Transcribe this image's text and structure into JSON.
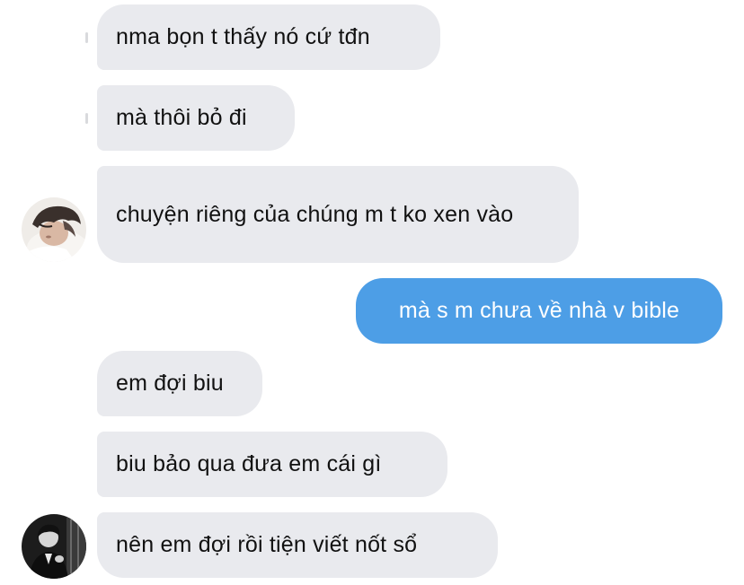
{
  "messages": [
    {
      "text": "nma bọn t thấy nó cứ tđn",
      "direction": "incoming"
    },
    {
      "text": "mà thôi bỏ đi",
      "direction": "incoming"
    },
    {
      "text": "chuyện riêng của chúng m t ko xen vào",
      "direction": "incoming"
    },
    {
      "text": "mà s m chưa về nhà v bible",
      "direction": "outgoing"
    },
    {
      "text": "em đợi biu",
      "direction": "incoming"
    },
    {
      "text": "biu bảo qua đưa em cái gì",
      "direction": "incoming"
    },
    {
      "text": "nên em đợi rồi tiện viết nốt sổ",
      "direction": "incoming"
    }
  ],
  "colors": {
    "incoming_bubble": "#e9eaee",
    "outgoing_bubble": "#4d9ee6",
    "incoming_text": "#111111",
    "outgoing_text": "#ffffff"
  }
}
